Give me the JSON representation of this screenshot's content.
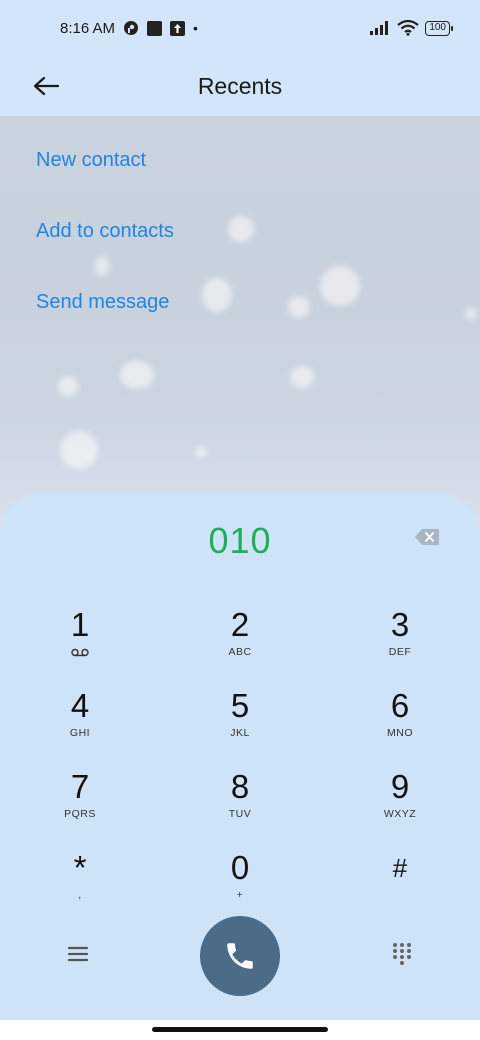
{
  "status_bar": {
    "time": "8:16 AM",
    "icons": [
      "vpn-key-icon",
      "square-notification-icon",
      "upload-icon",
      "dot-icon",
      "signal-icon",
      "wifi-icon"
    ],
    "dot": "•",
    "battery": "100"
  },
  "app_bar": {
    "title": "Recents",
    "back_icon": "arrow-left-icon"
  },
  "options": {
    "new_contact": "New contact",
    "add_to_contacts": "Add to contacts",
    "send_message": "Send message"
  },
  "dialer": {
    "number": "010",
    "backspace_icon": "backspace-icon",
    "keys": [
      {
        "digit": "1",
        "letters": ""
      },
      {
        "digit": "2",
        "letters": "ABC"
      },
      {
        "digit": "3",
        "letters": "DEF"
      },
      {
        "digit": "4",
        "letters": "GHI"
      },
      {
        "digit": "5",
        "letters": "JKL"
      },
      {
        "digit": "6",
        "letters": "MNO"
      },
      {
        "digit": "7",
        "letters": "PQRS"
      },
      {
        "digit": "8",
        "letters": "TUV"
      },
      {
        "digit": "9",
        "letters": "WXYZ"
      },
      {
        "digit": "*",
        "letters": ","
      },
      {
        "digit": "0",
        "letters": "+"
      },
      {
        "digit": "#",
        "letters": ""
      }
    ],
    "actions": {
      "menu_icon": "menu-icon",
      "call_icon": "phone-icon",
      "keypad_icon": "dialpad-icon"
    }
  },
  "colors": {
    "link": "#1f84e5",
    "number": "#1ab158",
    "call_button": "#4b6b88",
    "panel": "#cfe3f8"
  }
}
